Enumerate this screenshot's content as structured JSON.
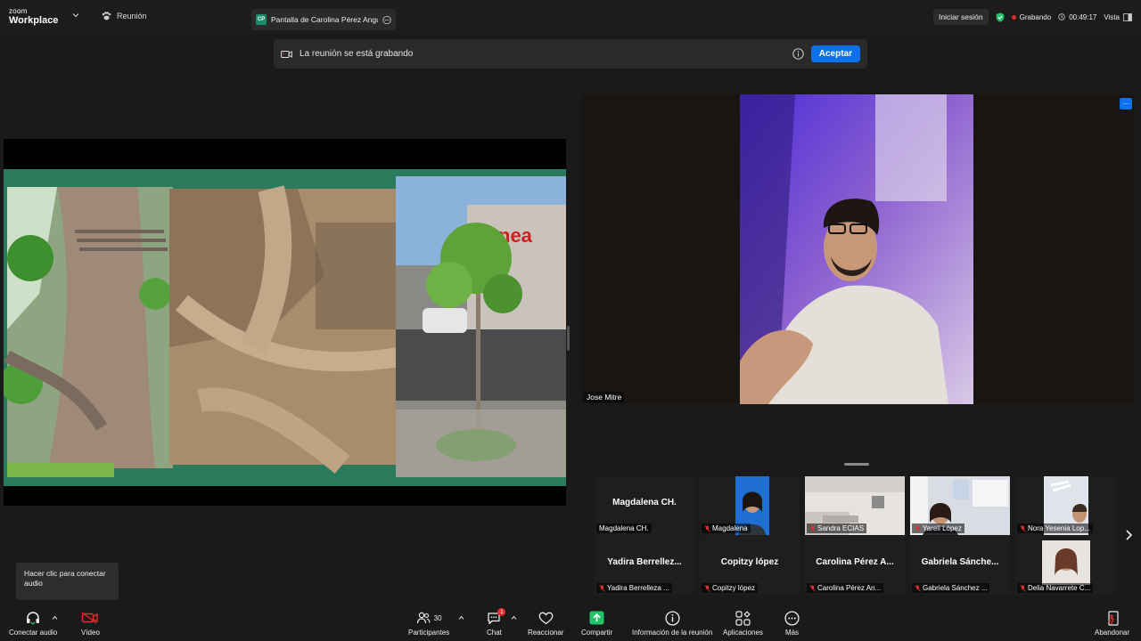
{
  "app": {
    "logo_top": "zoom",
    "logo_bottom": "Workplace"
  },
  "header": {
    "meeting_label": "Reunión",
    "share_tab_initials": "CP",
    "share_tab_title": "Pantalla de Carolina Pérez Angulo",
    "sign_in": "Iniciar sesión",
    "recording_status": "Grabando",
    "timer": "00:49:17",
    "view_label": "Vista"
  },
  "banner": {
    "message": "La reunión se está grabando",
    "accept_label": "Aceptar"
  },
  "speaker": {
    "name": "Jose Mitre",
    "more": "···"
  },
  "gallery": {
    "row1": [
      {
        "big": "Magdalena CH.",
        "label": "Magdalena CH.",
        "muted": false
      },
      {
        "big": "",
        "label": "Magdalena",
        "muted": true
      },
      {
        "big": "",
        "label": "Sandra ECIAS",
        "muted": true
      },
      {
        "big": "",
        "label": "Yareli López",
        "muted": true
      },
      {
        "big": "",
        "label": "Nora Yesenia Lop...",
        "muted": true
      }
    ],
    "row2": [
      {
        "big": "Yadira  Berrellez...",
        "label": "Yadira Berrelleza ...",
        "muted": true
      },
      {
        "big": "Copitzy lópez",
        "label": "Copitzy lópez",
        "muted": true
      },
      {
        "big": "Carolina  Pérez  A...",
        "label": "Carolina Pérez An...",
        "muted": true
      },
      {
        "big": "Gabriela  Sánche...",
        "label": "Gabriela Sánchez ...",
        "muted": true
      },
      {
        "big": "",
        "label": "Delia Navarrete C...",
        "muted": true
      }
    ]
  },
  "tooltip": {
    "text": "Hacer clic para conectar audio"
  },
  "toolbar": {
    "connect_audio": "Conectar audio",
    "video": "Vídeo",
    "participants": "Participantes",
    "participants_count": "30",
    "chat": "Chat",
    "chat_badge": "1",
    "reactions": "Reaccionar",
    "share": "Compartir",
    "meeting_info": "Información de la reunión",
    "apps": "Aplicaciones",
    "more": "Más",
    "leave": "Abandonar"
  },
  "colors": {
    "accent": "#0e71eb",
    "share_green": "#23c36a",
    "recording_red": "#e02f2f",
    "slide_green": "#2a7a5c"
  }
}
